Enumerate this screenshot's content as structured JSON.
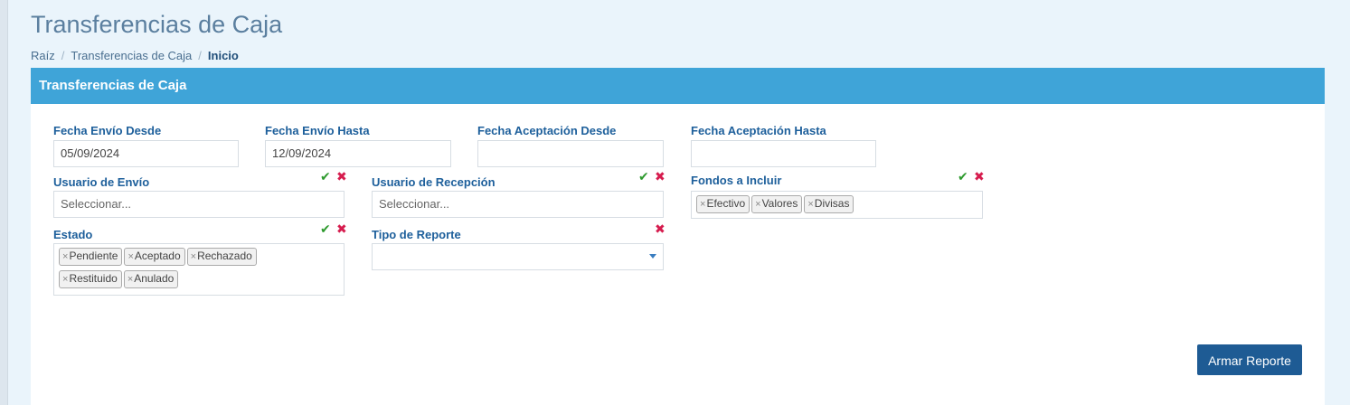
{
  "page": {
    "title": "Transferencias de Caja"
  },
  "breadcrumb": [
    "Raíz",
    "Transferencias de Caja",
    "Inicio"
  ],
  "panel": {
    "title": "Transferencias de Caja"
  },
  "filters": {
    "fecha_envio_desde": {
      "label": "Fecha Envío Desde",
      "value": "05/09/2024"
    },
    "fecha_envio_hasta": {
      "label": "Fecha Envío Hasta",
      "value": "12/09/2024"
    },
    "fecha_aceptacion_desde": {
      "label": "Fecha Aceptación Desde",
      "value": ""
    },
    "fecha_aceptacion_hasta": {
      "label": "Fecha Aceptación Hasta",
      "value": ""
    },
    "usuario_envio": {
      "label": "Usuario de Envío",
      "placeholder": "Seleccionar..."
    },
    "usuario_recepcion": {
      "label": "Usuario de Recepción",
      "placeholder": "Seleccionar..."
    },
    "fondos": {
      "label": "Fondos a Incluir",
      "tags": [
        "Efectivo",
        "Valores",
        "Divisas"
      ]
    },
    "estado": {
      "label": "Estado",
      "tags": [
        "Pendiente",
        "Aceptado",
        "Rechazado",
        "Restituido",
        "Anulado"
      ]
    },
    "tipo_reporte": {
      "label": "Tipo de Reporte",
      "value": ""
    }
  },
  "icons": {
    "select_all": "check-icon",
    "clear": "x-icon",
    "tag_remove": "×"
  },
  "actions": {
    "armar_reporte": "Armar Reporte"
  },
  "colors": {
    "header": "#3fa4d8",
    "button": "#1e5b94",
    "check": "#2e9a2e",
    "clear": "#d61c4e",
    "label": "#1d5f9b"
  }
}
